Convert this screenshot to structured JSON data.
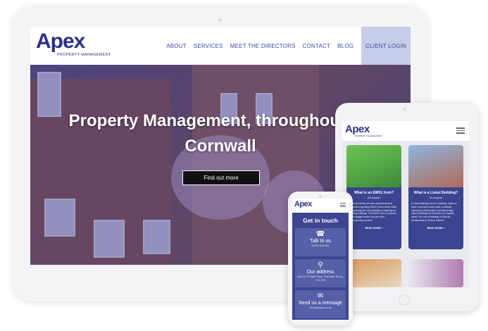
{
  "desktop": {
    "logo": {
      "word": "Apex",
      "tagline": "PROPERTY MANAGEMENT"
    },
    "nav": [
      "ABOUT",
      "SERVICES",
      "MEET THE DIRECTORS",
      "CONTACT",
      "BLOG"
    ],
    "client_login": "CLIENT LOGIN",
    "hero": {
      "title_line1": "Property Management, throughout De",
      "title_line2": "Cornwall",
      "button": "Find out more"
    }
  },
  "tablet": {
    "logo": "Apex",
    "logo_sub": "PROPERTY MANAGEMENT",
    "cards": [
      {
        "title": "What is an EWS1 form?",
        "date": "28 August",
        "text": "In recent weeks we have received several enquiries regarding EWS1 Forms which relate to assessing the combustibility of cladding on existing buildings. The EWS1 form is required by mortgage lenders as part of the conveyancing process.",
        "link": "READ MORE »",
        "img_color": "#55b244"
      },
      {
        "title": "What is a Listed Building?",
        "date": "21 August",
        "text": "A Listed Building can be a building, object or even a structure which holds a national importance (historically or architecturally). Listed Buildings are included on a register called 'The List of Buildings of Special Architectural or Historic Interest'.",
        "link": "READ MORE »",
        "img_color": "#7aa0c8"
      }
    ]
  },
  "phone": {
    "logo": "Apex",
    "title": "Get in touch",
    "blocks": [
      {
        "icon": "phone-icon",
        "label": "Talk to us",
        "sub": "01752 XXXXXX"
      },
      {
        "icon": "location-icon",
        "label": "Our address",
        "sub": "Unit 12, 3 Chapel Drive, Plymouth, Devon, PL1 2JB"
      },
      {
        "icon": "mail-icon",
        "label": "Send us a message",
        "sub": "info@apexpm.co.uk"
      }
    ]
  },
  "colors": {
    "brand": "#2e2f8a",
    "nav": "#3b4aa0",
    "login_bg": "#c6cde8",
    "card": "#3a4490"
  }
}
